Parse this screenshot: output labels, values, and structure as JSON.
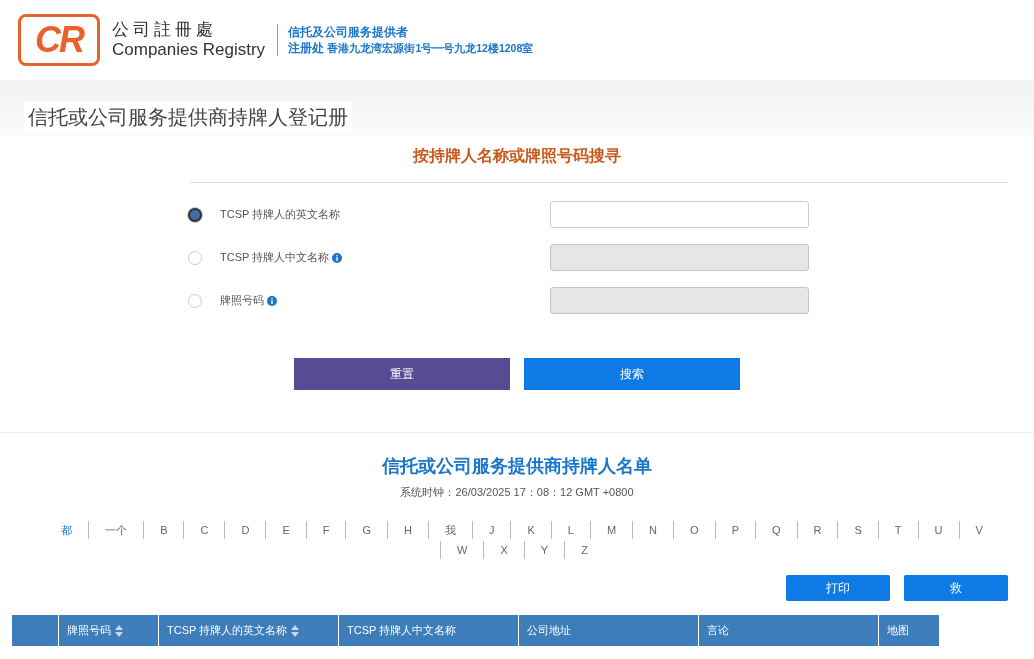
{
  "header": {
    "logo_mark": "CR",
    "logo_name_zh": "公司註冊處",
    "logo_name_en": "Companies Registry",
    "service_title": "信托及公司服务提供者",
    "registry_label": "注册处",
    "registry_address": "香港九龙湾宏源街1号一号九龙12楼1208室"
  },
  "page_title": "信托或公司服务提供商持牌人登记册",
  "search": {
    "heading": "按持牌人名称或牌照号码搜寻",
    "options": [
      {
        "label": "TCSP 持牌人的英文名称",
        "selected": true,
        "info": false,
        "disabled": false
      },
      {
        "label": "TCSP 持牌人中文名称",
        "selected": false,
        "info": true,
        "disabled": true
      },
      {
        "label": "牌照号码",
        "selected": false,
        "info": true,
        "disabled": true
      }
    ],
    "buttons": [
      {
        "label": "重置",
        "kind": "reset"
      },
      {
        "label": "搜索",
        "kind": "search"
      }
    ]
  },
  "list": {
    "heading": "信托或公司服务提供商持牌人名单",
    "clock": "系统时钟：26/03/2025 17：08：12 GMT +0800",
    "letters": [
      {
        "label": "都",
        "selected": true
      },
      {
        "label": "一个",
        "selected": false
      },
      {
        "label": "B",
        "selected": false
      },
      {
        "label": "C",
        "selected": false
      },
      {
        "label": "D",
        "selected": false
      },
      {
        "label": "E",
        "selected": false
      },
      {
        "label": "F",
        "selected": false
      },
      {
        "label": "G",
        "selected": false
      },
      {
        "label": "H",
        "selected": false
      },
      {
        "label": "我",
        "selected": false
      },
      {
        "label": "J",
        "selected": false
      },
      {
        "label": "K",
        "selected": false
      },
      {
        "label": "L",
        "selected": false
      },
      {
        "label": "M",
        "selected": false
      },
      {
        "label": "N",
        "selected": false
      },
      {
        "label": "O",
        "selected": false
      },
      {
        "label": "P",
        "selected": false
      },
      {
        "label": "Q",
        "selected": false
      },
      {
        "label": "R",
        "selected": false
      },
      {
        "label": "S",
        "selected": false
      },
      {
        "label": "T",
        "selected": false
      },
      {
        "label": "U",
        "selected": false
      },
      {
        "label": "V",
        "selected": false
      },
      {
        "label": "W",
        "selected": false
      },
      {
        "label": "X",
        "selected": false
      },
      {
        "label": "Y",
        "selected": false
      },
      {
        "label": "Z",
        "selected": false
      }
    ],
    "actions": [
      "打印",
      "救"
    ],
    "table": {
      "columns": [
        {
          "label": "牌照号码",
          "sortable": true
        },
        {
          "label": "TCSP 持牌人的英文名称",
          "sortable": true
        },
        {
          "label": "TCSP 持牌人中文名称",
          "sortable": false
        },
        {
          "label": "公司地址",
          "sortable": false
        },
        {
          "label": "言论",
          "sortable": false
        },
        {
          "label": "地图",
          "sortable": false
        }
      ]
    }
  }
}
